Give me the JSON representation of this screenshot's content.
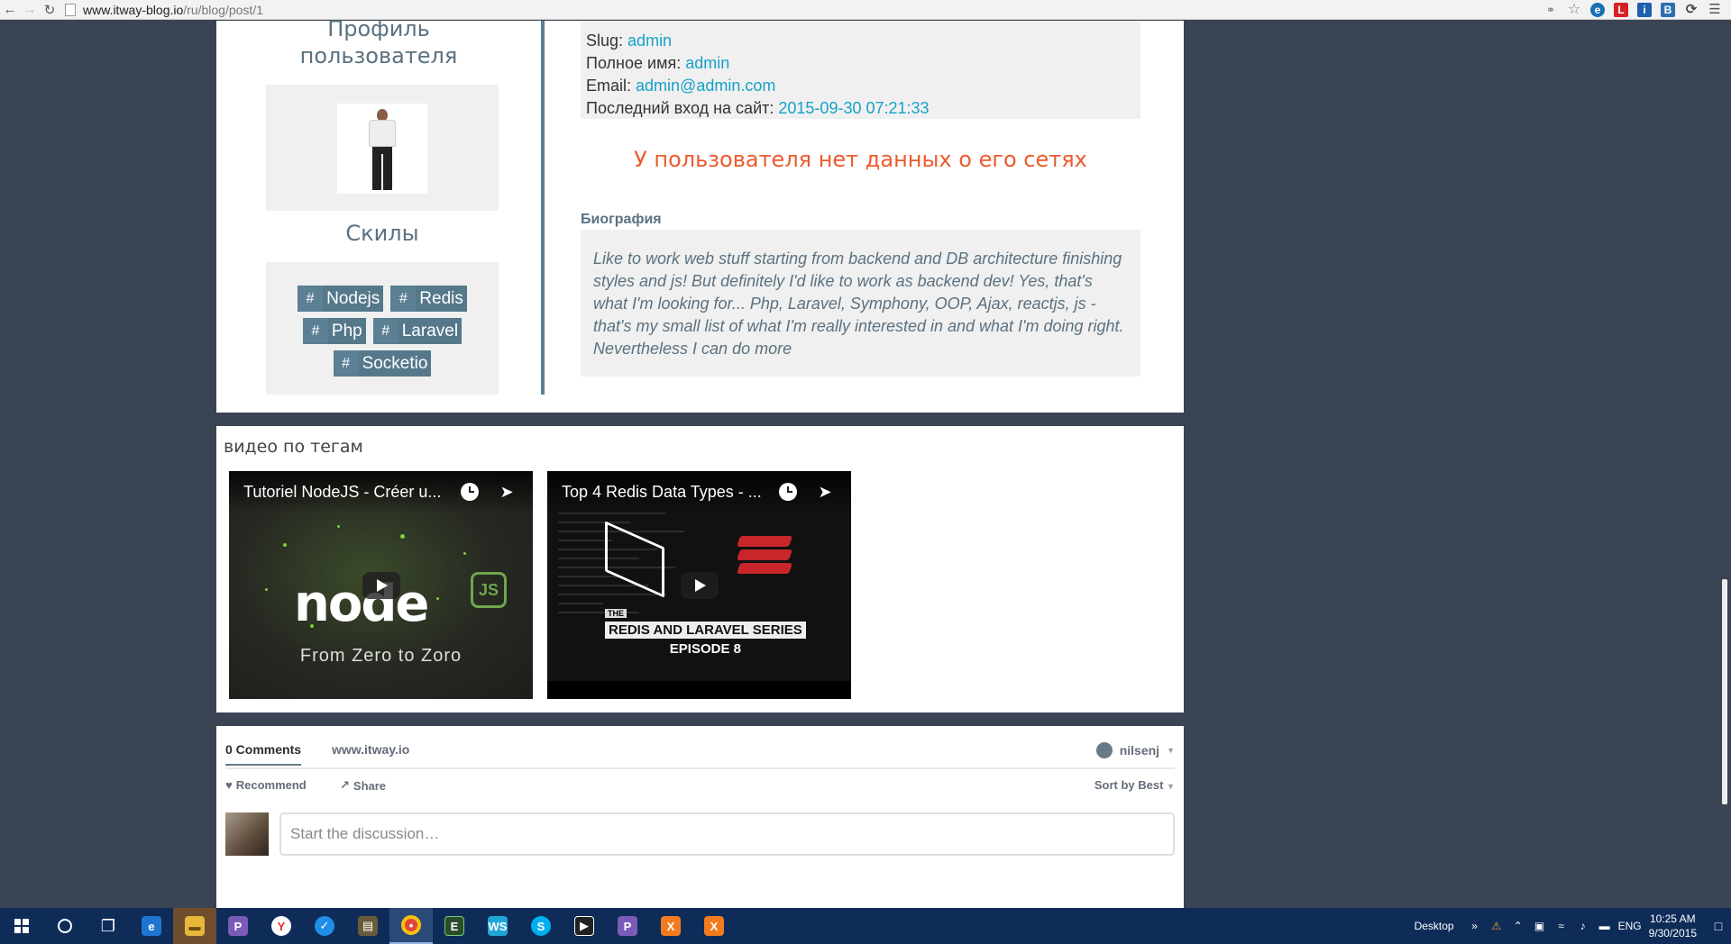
{
  "browser": {
    "url_host": "www.itway-blog.io",
    "url_path": "/ru/blog/post/1",
    "back_icon": "back-arrow-icon",
    "forward_icon": "forward-arrow-icon",
    "reload_icon": "reload-icon"
  },
  "profile": {
    "title": "Профиль пользователя",
    "skills_title": "Скилы",
    "tags": [
      {
        "hash": "#",
        "name": "Nodejs"
      },
      {
        "hash": "#",
        "name": "Redis"
      },
      {
        "hash": "#",
        "name": "Php"
      },
      {
        "hash": "#",
        "name": "Laravel"
      },
      {
        "hash": "#",
        "name": "Socketio"
      }
    ]
  },
  "info": {
    "slug_label": "Slug:",
    "slug_value": "admin",
    "fullname_label": "Полное имя:",
    "fullname_value": "admin",
    "email_label": "Email:",
    "email_value": "admin@admin.com",
    "lastlogin_label": "Последний вход на сайт:",
    "lastlogin_value": "2015-09-30 07:21:33",
    "no_networks": "У пользователя нет данных о его сетях",
    "bio_label": "Биография",
    "bio_text": "Like to work web stuff starting from backend and DB architecture finishing styles and js! But definitely I'd like to work as backend dev! Yes, that's what I'm looking for... Php, Laravel, Symphony, OOP, Ajax, reactjs, js - that's my small list of what I'm really interested in and what I'm doing right. Nevertheless I can do more"
  },
  "videos": {
    "title": "видео по тегам",
    "items": [
      {
        "title": "Tutoriel NodeJS - Créer u...",
        "logo": "node",
        "logo_js": "JS",
        "caption": "From Zero to Zoro"
      },
      {
        "title": "Top 4 Redis Data Types - ...",
        "the": "THE",
        "series": "REDIS AND LARAVEL SERIES",
        "episode": "EPISODE 8"
      }
    ]
  },
  "comments": {
    "count_tab": "0 Comments",
    "site_tab": "www.itway.io",
    "user": "nilsenj",
    "recommend": "Recommend",
    "share": "Share",
    "sort": "Sort by Best",
    "placeholder": "Start the discussion…"
  },
  "taskbar": {
    "desktop_label": "Desktop",
    "lang": "ENG",
    "time": "10:25 AM",
    "date": "9/30/2015"
  },
  "colors": {
    "accent_link": "#16a1c9",
    "tag_bg": "#5b7f93",
    "warning_text": "#ec5b2d",
    "page_bg": "#3b4452",
    "taskbar_bg": "#0f2c59"
  }
}
